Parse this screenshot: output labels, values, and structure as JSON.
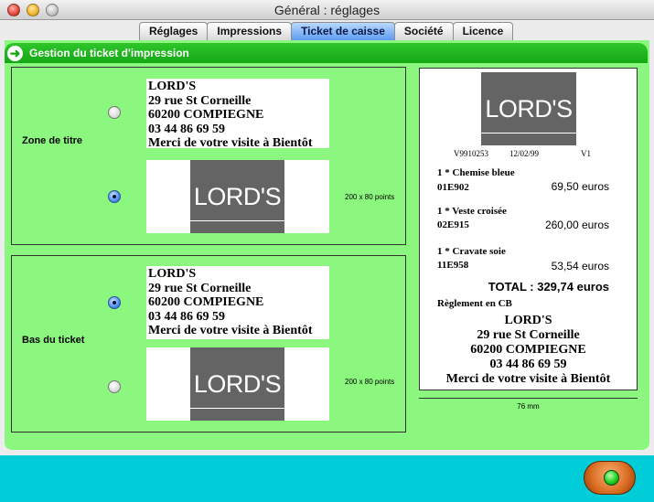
{
  "window": {
    "title": "Général : réglages"
  },
  "tabs": [
    {
      "label": "Réglages",
      "active": false
    },
    {
      "label": "Impressions",
      "active": false
    },
    {
      "label": "Ticket de caisse",
      "active": true
    },
    {
      "label": "Société",
      "active": false
    },
    {
      "label": "Licence",
      "active": false
    }
  ],
  "section": {
    "title": "Gestion du ticket d'impression"
  },
  "title_zone": {
    "label": "Zone de titre",
    "text_option": {
      "lines": [
        "LORD'S",
        "29 rue St Corneille",
        "60200 COMPIEGNE",
        "03 44 86 69 59",
        "Merci de votre visite à Bientôt"
      ],
      "selected": false
    },
    "logo_option": {
      "logo_text": "LORD'S",
      "size_note": "200 x 80 points",
      "selected": true
    }
  },
  "bottom_zone": {
    "label": "Bas du ticket",
    "text_option": {
      "lines": [
        "LORD'S",
        "29 rue St Corneille",
        "60200 COMPIEGNE",
        "03 44 86 69 59",
        "Merci de votre visite à Bientôt"
      ],
      "selected": true
    },
    "logo_option": {
      "logo_text": "LORD'S",
      "size_note": "200 x 80 points",
      "selected": false
    }
  },
  "preview": {
    "logo_text": "LORD'S",
    "ticket_id": "V9910253",
    "date": "12/02/99",
    "register": "V1",
    "items": [
      {
        "name": "1 * Chemise bleue",
        "code": "01E902",
        "price": "69,50 euros"
      },
      {
        "name": "1 * Veste croisée",
        "code": "02E915",
        "price": "260,00 euros"
      },
      {
        "name": "1 * Cravate soie",
        "code": "11E958",
        "price": "53,54 euros"
      }
    ],
    "total": "TOTAL : 329,74 euros",
    "payment": "Règlement en CB",
    "footer_lines": [
      "LORD'S",
      "29 rue St Corneille",
      "60200 COMPIEGNE",
      "03 44 86 69 59",
      "Merci de votre visite à Bientôt"
    ],
    "width_label": "76 mm"
  },
  "colors": {
    "panel_green": "#8cf77e",
    "header_green": "#14a814",
    "bottom_bar": "#00cdd7",
    "logo_gray": "#646464",
    "tab_active": "#5d9bef"
  },
  "icons": {
    "header_arrow": "arrow-right-icon",
    "go_button": "green-light-icon"
  }
}
